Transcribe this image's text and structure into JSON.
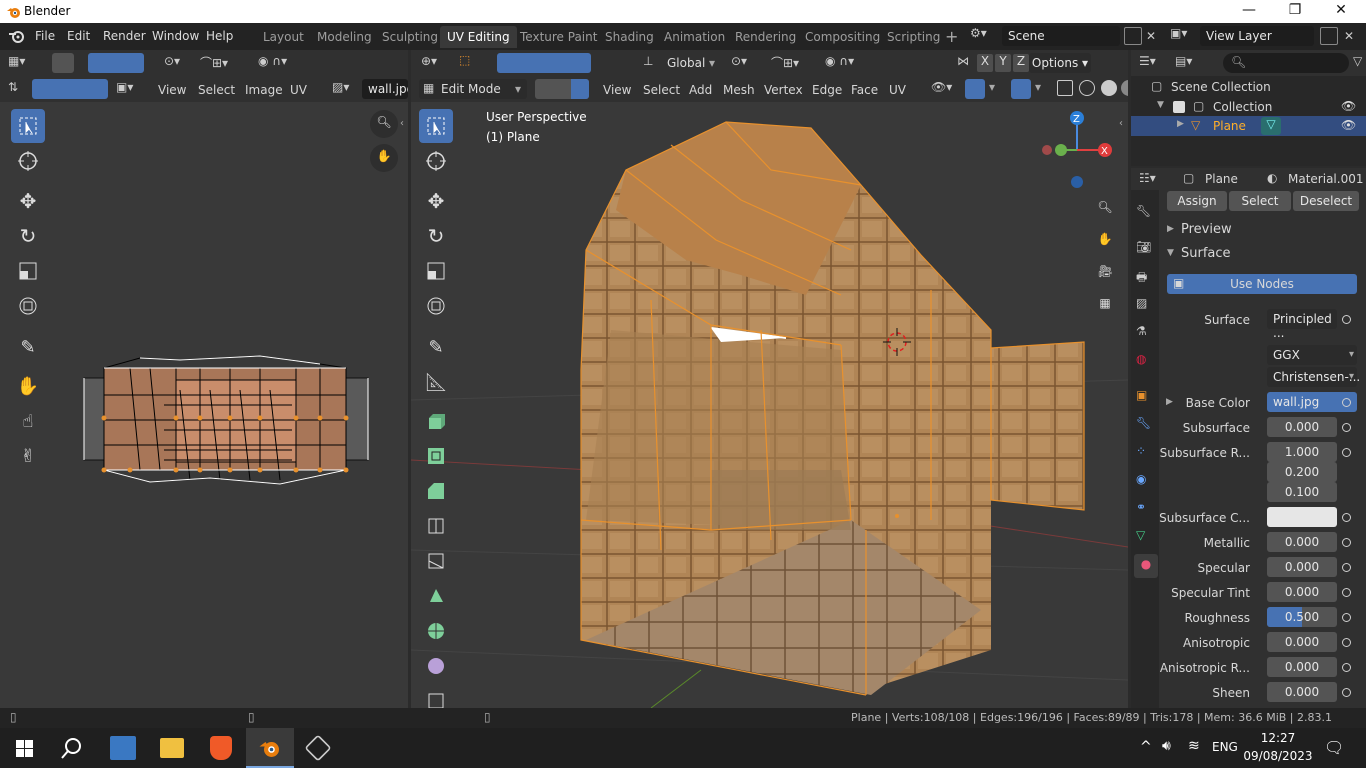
{
  "window": {
    "title": "Blender"
  },
  "menubar": {
    "items": [
      "File",
      "Edit",
      "Render",
      "Window",
      "Help"
    ]
  },
  "workspaces": [
    "Layout",
    "Modeling",
    "Sculpting",
    "UV Editing",
    "Texture Paint",
    "Shading",
    "Animation",
    "Rendering",
    "Compositing",
    "Scripting"
  ],
  "active_workspace": "UV Editing",
  "scene": {
    "name": "Scene",
    "view_layer": "View Layer"
  },
  "uv_editor": {
    "menus": [
      "View",
      "Select",
      "Image",
      "UV"
    ],
    "image": "wall.jpg"
  },
  "viewport": {
    "mode": "Edit Mode",
    "menus": [
      "View",
      "Select",
      "Add",
      "Mesh",
      "Vertex",
      "Edge",
      "Face",
      "UV"
    ],
    "transform": "Global",
    "options": "Options",
    "overlay_line1": "User Perspective",
    "overlay_line2": "(1) Plane",
    "axes": {
      "x": "X",
      "y": "Y",
      "z": "Z"
    }
  },
  "outliner": {
    "items": [
      {
        "label": "Scene Collection"
      },
      {
        "label": "Collection"
      },
      {
        "label": "Plane"
      }
    ]
  },
  "properties": {
    "object": "Plane",
    "material": "Material.001",
    "buttons": [
      "Assign",
      "Select",
      "Deselect"
    ],
    "sections": {
      "preview": "Preview",
      "surface": "Surface"
    },
    "use_nodes": "Use Nodes",
    "rows": [
      {
        "label": "Surface",
        "value": "Principled ..."
      },
      {
        "label": "",
        "value": "GGX"
      },
      {
        "label": "",
        "value": "Christensen-..."
      },
      {
        "label": "Base Color",
        "value": "wall.jpg"
      },
      {
        "label": "Subsurface",
        "value": "0.000"
      },
      {
        "label": "Subsurface R...",
        "value": "1.000"
      },
      {
        "label": "",
        "value": "0.200"
      },
      {
        "label": "",
        "value": "0.100"
      },
      {
        "label": "Subsurface C...",
        "value": ""
      },
      {
        "label": "Metallic",
        "value": "0.000"
      },
      {
        "label": "Specular",
        "value": "0.000"
      },
      {
        "label": "Specular Tint",
        "value": "0.000"
      },
      {
        "label": "Roughness",
        "value": "0.500"
      },
      {
        "label": "Anisotropic",
        "value": "0.000"
      },
      {
        "label": "Anisotropic R...",
        "value": "0.000"
      },
      {
        "label": "Sheen",
        "value": "0.000"
      }
    ],
    "roughness_fraction": 0.5
  },
  "statusbar": {
    "text": "Plane | Verts:108/108 | Edges:196/196 | Faces:89/89 | Tris:178 | Mem: 36.6 MiB | 2.83.1"
  },
  "taskbar": {
    "language": "ENG",
    "time": "12:27",
    "date": "09/08/2023"
  },
  "colors": {
    "accent": "#4772b3",
    "orange": "#e8912d",
    "header": "#303030",
    "bg": "#393939"
  }
}
